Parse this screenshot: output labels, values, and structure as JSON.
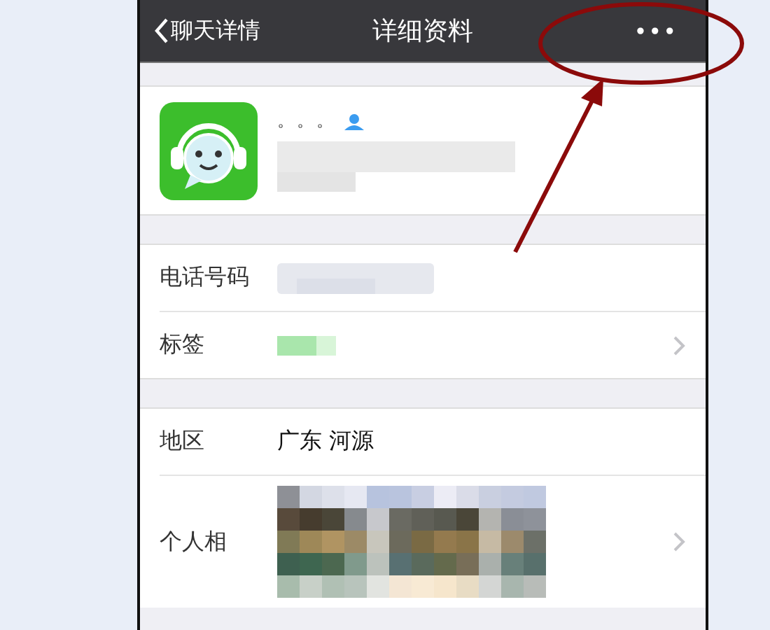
{
  "nav": {
    "back": "聊天详情",
    "title": "详细资料",
    "more": "•••"
  },
  "profile": {
    "name": "。。。"
  },
  "groups": [
    [
      {
        "kind": "blurred",
        "label": "电话号码",
        "chevron": false
      },
      {
        "kind": "tag",
        "label": "标签",
        "chevron": true
      }
    ],
    [
      {
        "kind": "text",
        "label": "地区",
        "value": "广东 河源",
        "chevron": false
      },
      {
        "kind": "album",
        "label": "个人相",
        "chevron": true
      }
    ]
  ]
}
